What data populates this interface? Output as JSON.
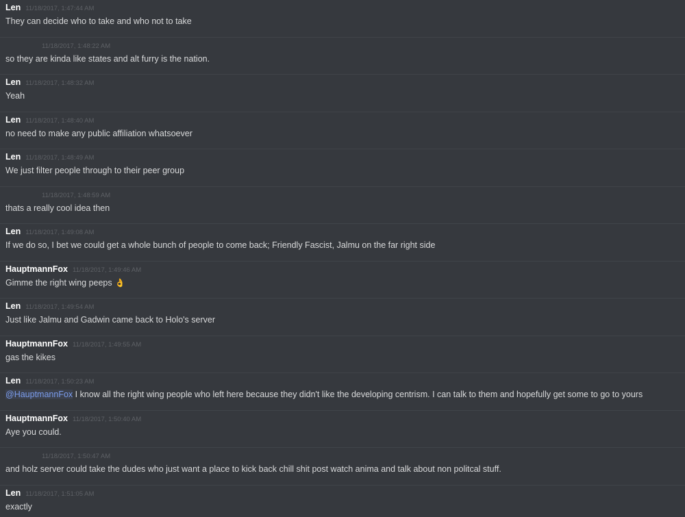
{
  "messages": [
    {
      "author": "Len",
      "timestamp": "11/18/2017, 1:47:44 AM",
      "text": "They can decide who to take and who not to take"
    },
    {
      "author": "",
      "timestamp": "11/18/2017, 1:48:22 AM",
      "text": "so they are kinda like states and alt furry is the nation."
    },
    {
      "author": "Len",
      "timestamp": "11/18/2017, 1:48:32 AM",
      "text": "Yeah"
    },
    {
      "author": "Len",
      "timestamp": "11/18/2017, 1:48:40 AM",
      "text": "no need to make any public affiliation whatsoever"
    },
    {
      "author": "Len",
      "timestamp": "11/18/2017, 1:48:49 AM",
      "text": "We just filter people through to their peer group"
    },
    {
      "author": "",
      "timestamp": "11/18/2017, 1:48:59 AM",
      "text": "thats a really cool idea then"
    },
    {
      "author": "Len",
      "timestamp": "11/18/2017, 1:49:08 AM",
      "text": "If we do so, I bet we could get a whole bunch of people to come back; Friendly Fascist, Jalmu on the far right side"
    },
    {
      "author": "HauptmannFox",
      "timestamp": "11/18/2017, 1:49:46 AM",
      "text": "Gimme the right wing peeps",
      "emoji": "👌"
    },
    {
      "author": "Len",
      "timestamp": "11/18/2017, 1:49:54 AM",
      "text": "Just like Jalmu and Gadwin came back to Holo's server"
    },
    {
      "author": "HauptmannFox",
      "timestamp": "11/18/2017, 1:49:55 AM",
      "text": "gas the kikes"
    },
    {
      "author": "Len",
      "timestamp": "11/18/2017, 1:50:23 AM",
      "mention": "@HauptmannFox",
      "text": " I know all the right wing people who left here because they didn't like the developing centrism. I can talk to them and hopefully get some to go to yours"
    },
    {
      "author": "HauptmannFox",
      "timestamp": "11/18/2017, 1:50:40 AM",
      "text": "Aye you could."
    },
    {
      "author": "",
      "timestamp": "11/18/2017, 1:50:47 AM",
      "text": "and holz server could take the dudes who just want a place to kick back chill shit post watch anima and talk about non politcal stuff."
    },
    {
      "author": "Len",
      "timestamp": "11/18/2017, 1:51:05 AM",
      "text": "exactly"
    }
  ],
  "colors": {
    "background": "#36393e",
    "author": "#ffffff",
    "timestamp": "#5e6166",
    "text": "#d8d9da",
    "mention": "#7b9dee"
  }
}
